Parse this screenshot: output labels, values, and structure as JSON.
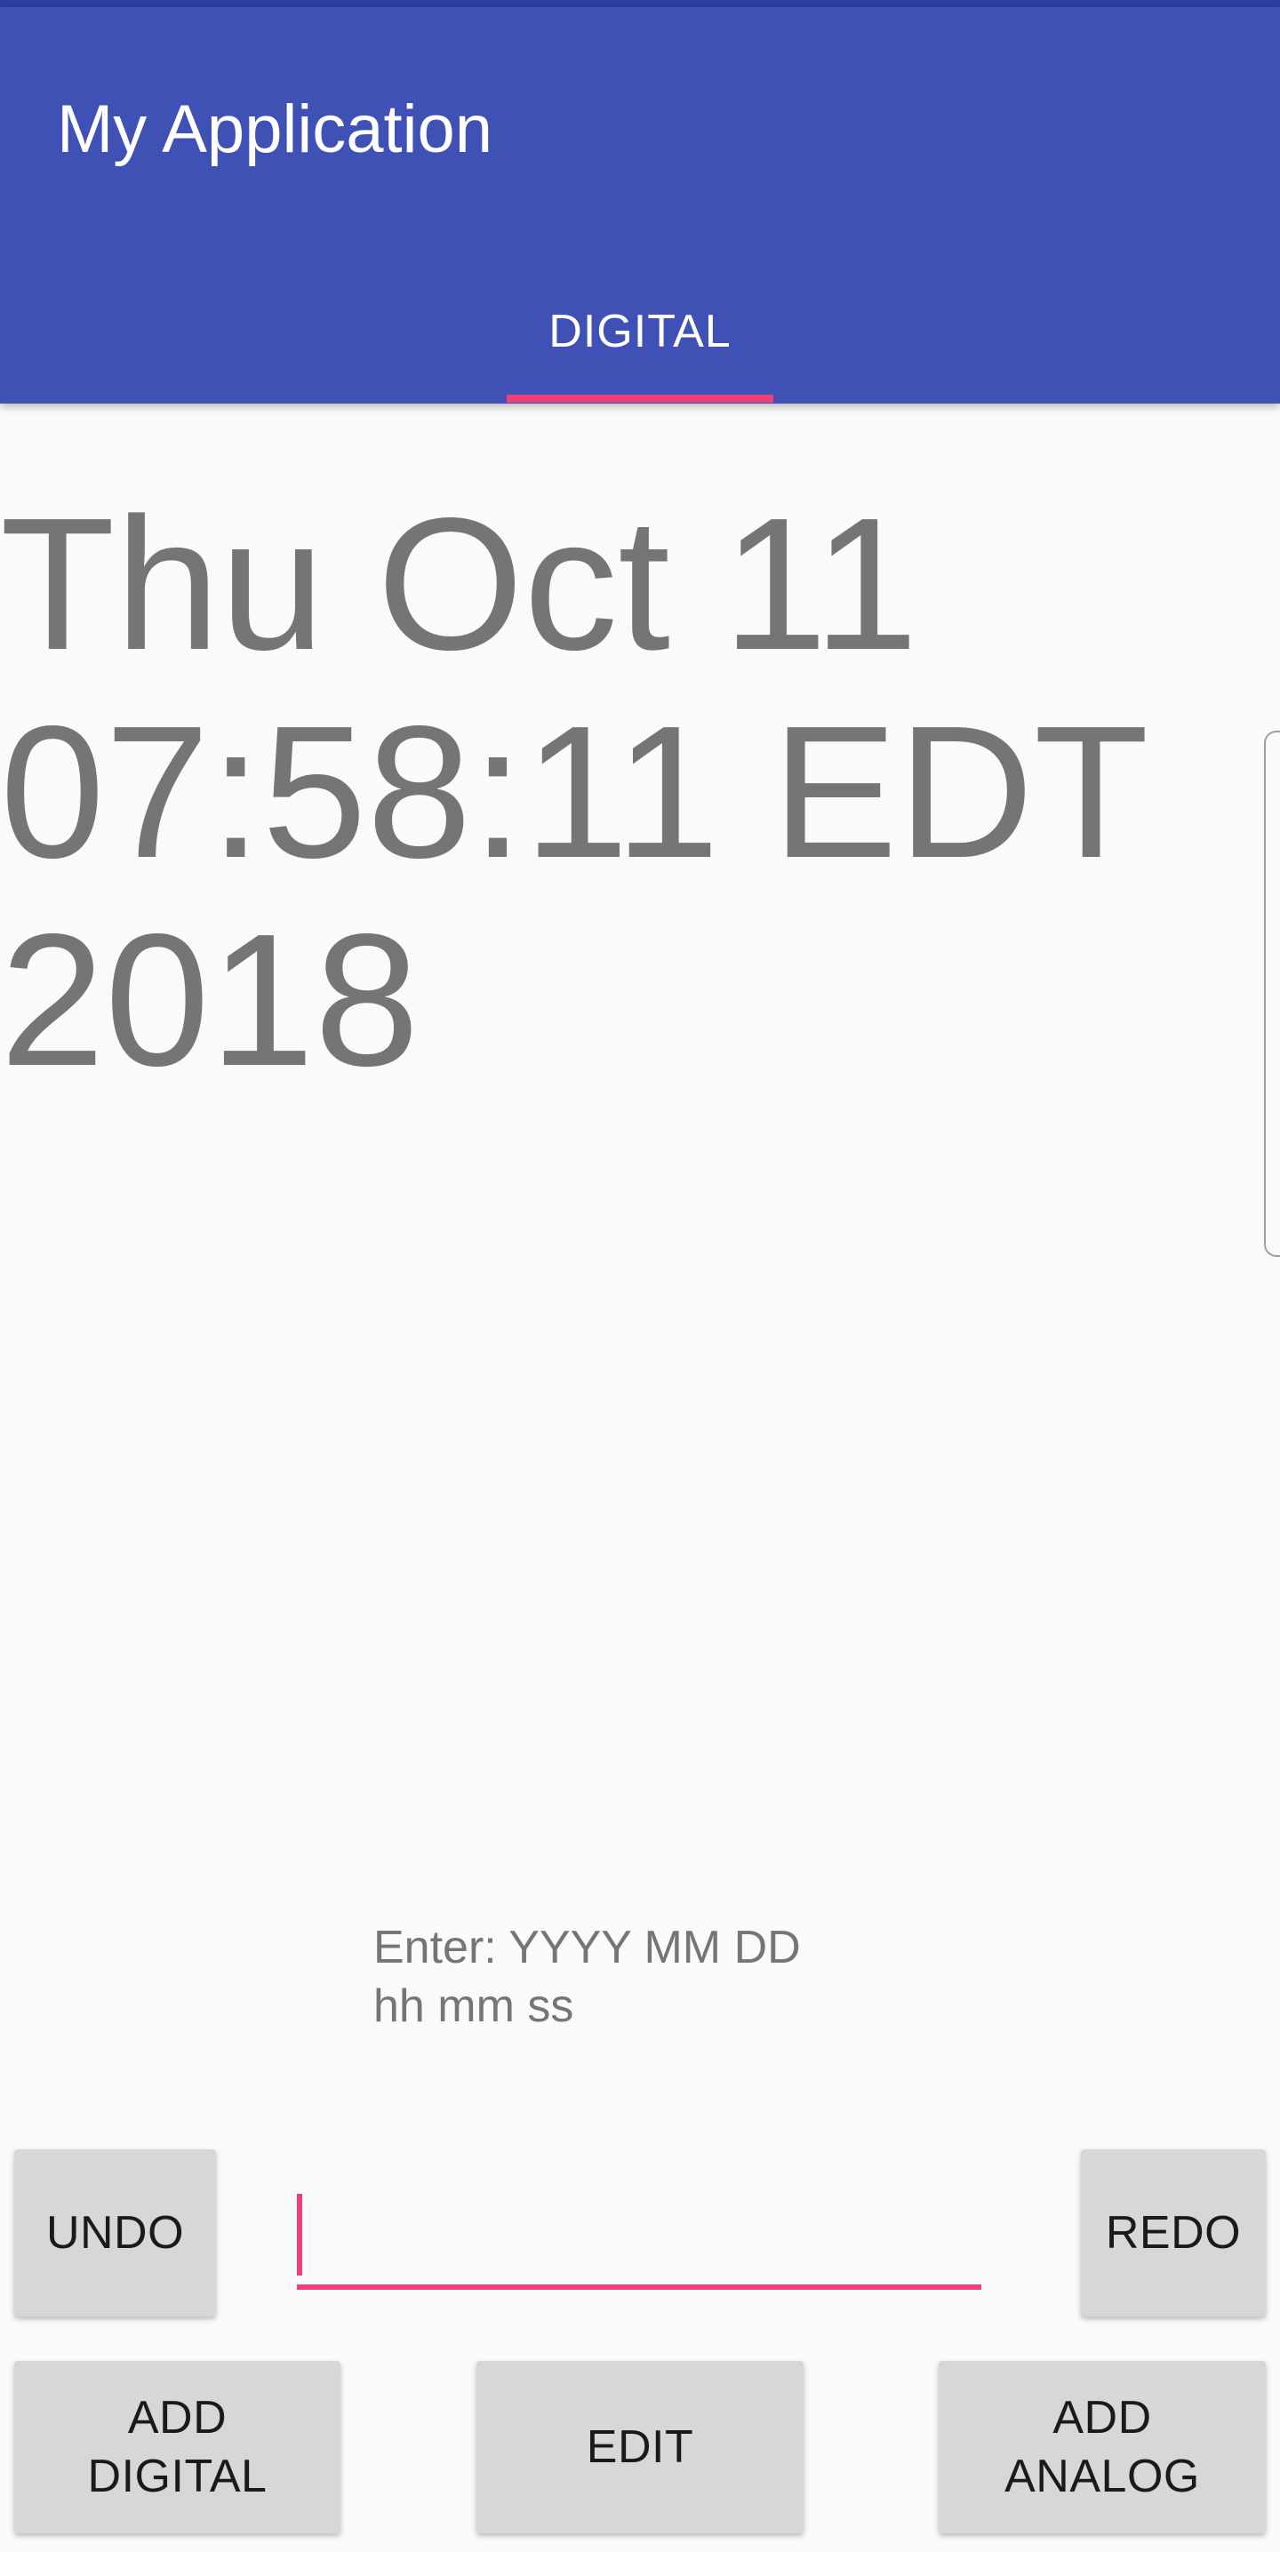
{
  "app_bar": {
    "title": "My Application",
    "tabs": [
      {
        "label": "DIGITAL",
        "selected": true
      }
    ]
  },
  "clock": {
    "display_text": "Thu Oct 11\n07:58:11 EDT\n2018"
  },
  "hint": {
    "text": "Enter: YYYY MM DD\nhh mm ss"
  },
  "input": {
    "value": "",
    "placeholder": ""
  },
  "buttons": {
    "undo": "UNDO",
    "redo": "REDO",
    "add_digital": "ADD\nDIGITAL",
    "edit": "EDIT",
    "add_analog": "ADD\nANALOG"
  },
  "colors": {
    "primary": "#3f51b5",
    "primary_dark": "#303f9f",
    "accent": "#ec407a",
    "background": "#fafafa",
    "button": "#d6d7d7",
    "clock_text": "#757575"
  }
}
